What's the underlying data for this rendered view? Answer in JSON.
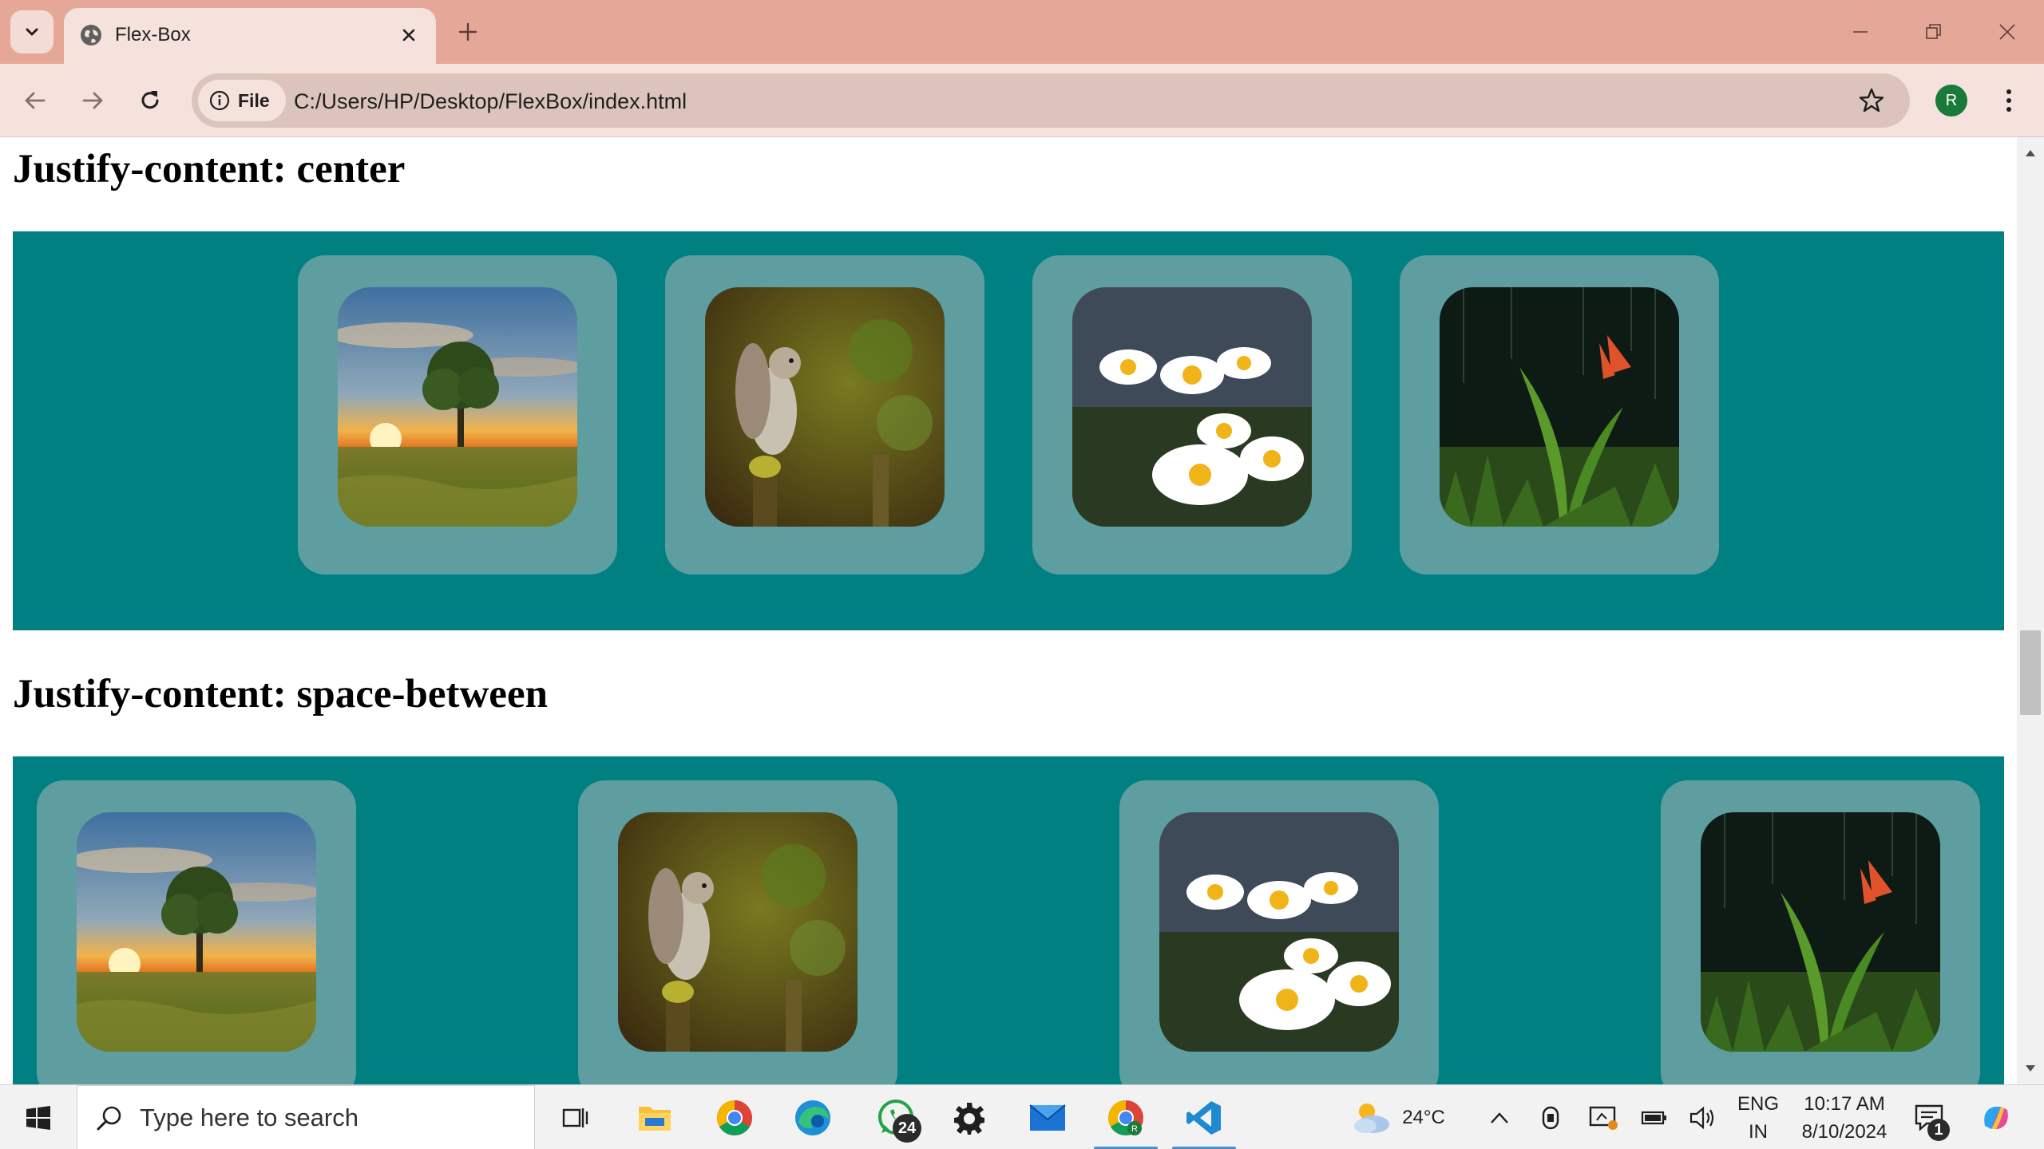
{
  "browser": {
    "tab_title": "Flex-Box",
    "security_chip": "File",
    "url": "C:/Users/HP/Desktop/FlexBox/index.html",
    "profile_initial": "R"
  },
  "page": {
    "sections": [
      {
        "heading": "Justify-content: center",
        "justify": "center",
        "images": [
          "sunset-tree-photo",
          "squirrel-photo",
          "daisies-photo",
          "rain-plant-photo"
        ]
      },
      {
        "heading": "Justify-content: space-between",
        "justify": "space-between",
        "images": [
          "sunset-tree-photo",
          "squirrel-photo",
          "daisies-photo",
          "rain-plant-photo"
        ]
      }
    ],
    "colors": {
      "container": "#008080",
      "card": "#5f9ea0"
    }
  },
  "taskbar": {
    "search_placeholder": "Type here to search",
    "whatsapp_badge": "24",
    "weather_temp": "24°C",
    "language": "ENG",
    "region": "IN",
    "time": "10:17 AM",
    "date": "8/10/2024",
    "notification_count": "1"
  },
  "icons": [
    "chevron-down-icon",
    "globe-icon",
    "close-icon",
    "plus-icon",
    "minimize-icon",
    "restore-icon",
    "back-icon",
    "forward-icon",
    "reload-icon",
    "info-icon",
    "star-icon",
    "kebab-menu-icon",
    "windows-start-icon",
    "search-icon",
    "task-view-icon",
    "file-explorer-icon",
    "chrome-icon",
    "edge-icon",
    "whatsapp-icon",
    "settings-gear-icon",
    "mail-icon",
    "vscode-icon",
    "weather-icon",
    "tray-chevron-up-icon",
    "meet-now-icon",
    "battery-icon",
    "volume-icon",
    "notification-icon",
    "copilot-icon"
  ]
}
